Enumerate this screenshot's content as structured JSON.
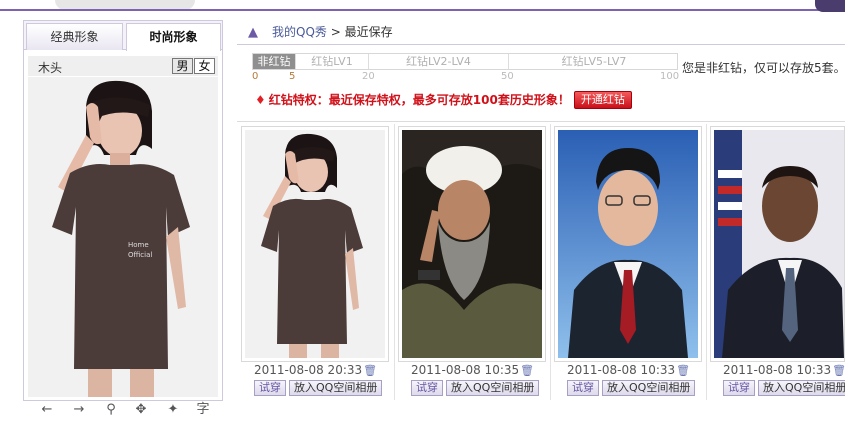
{
  "tabs": {
    "classic": "经典形象",
    "fashion": "时尚形象"
  },
  "avatar": {
    "name": "木头",
    "male": "男",
    "female": "女"
  },
  "toolbar": {
    "text_tool": "字"
  },
  "breadcrumb": {
    "root": "我的QQ秀",
    "separator": ">",
    "current": "最近保存"
  },
  "levels": {
    "segments": [
      "非红钻",
      "红钻LV1",
      "红钻LV2-LV4",
      "红钻LV5-LV7"
    ],
    "ticks": [
      "0",
      "5",
      "20",
      "50",
      "100"
    ],
    "note": "您是非红钻，仅可以存放5套。"
  },
  "privilege": {
    "text": "红钻特权：最近保存特权，最多可存放100套历史形象！",
    "button": "开通红钻"
  },
  "actions": {
    "try": "试穿",
    "album": "放入QQ空间相册"
  },
  "items": [
    {
      "date": "2011-08-08 20:33",
      "image": "girl-in-brown-tshirt"
    },
    {
      "date": "2011-08-08 10:35",
      "image": "bearded-man-in-turban"
    },
    {
      "date": "2011-08-08 10:33",
      "image": "man-in-suit-red-tie"
    },
    {
      "date": "2011-08-08 10:33",
      "image": "man-in-suit-flag-background"
    }
  ],
  "colors": {
    "accent": "#7d62b4",
    "red": "#d1111a",
    "level_tick": "#b57b3b"
  }
}
